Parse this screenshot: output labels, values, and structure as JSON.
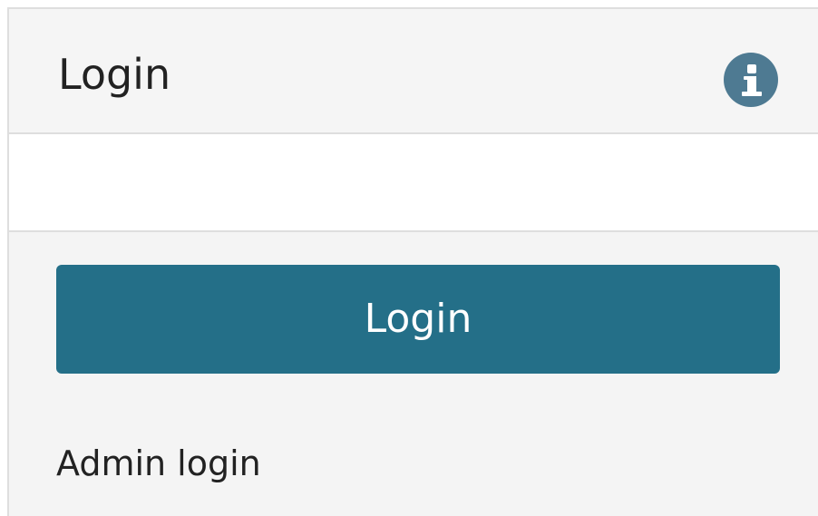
{
  "header": {
    "title": "Login",
    "info_icon": "info-circle-icon"
  },
  "footer": {
    "login_button_label": "Login",
    "admin_login_link": "Admin login"
  },
  "colors": {
    "primary_button": "#246f88",
    "info_icon": "#4e7a92",
    "panel_background": "#f4f4f4",
    "border": "#dedede"
  }
}
